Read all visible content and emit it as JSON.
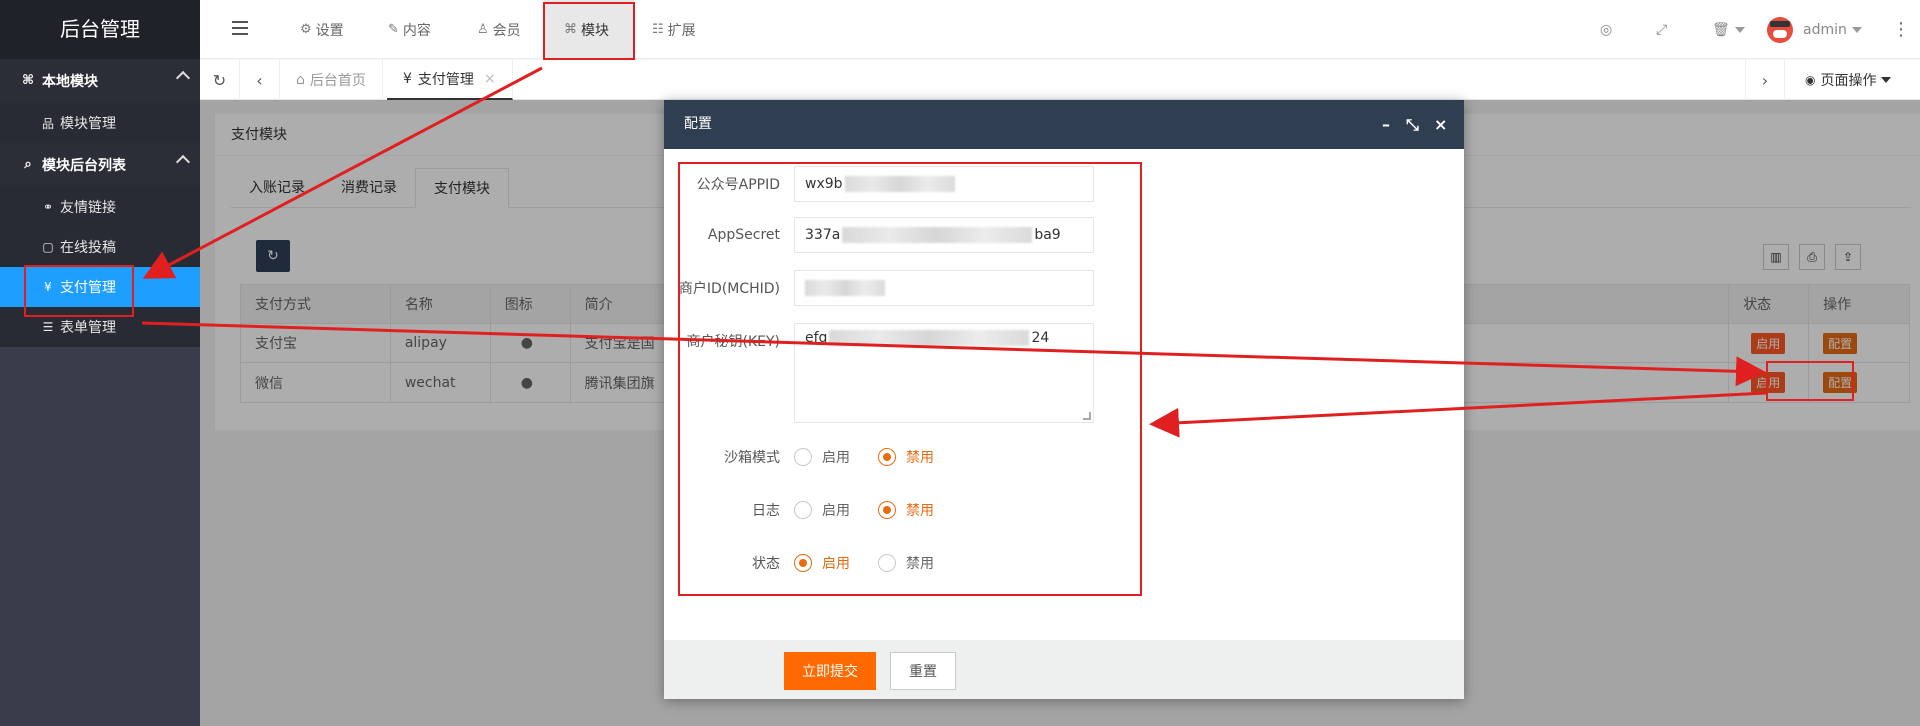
{
  "sidebar": {
    "logo": "后台管理",
    "groups": [
      {
        "label": "本地模块",
        "items": [
          {
            "label": "模块管理"
          }
        ]
      },
      {
        "label": "模块后台列表",
        "items": [
          {
            "label": "友情链接"
          },
          {
            "label": "在线投稿"
          },
          {
            "label": "支付管理"
          },
          {
            "label": "表单管理"
          }
        ]
      }
    ]
  },
  "header": {
    "nav": [
      {
        "label": "设置"
      },
      {
        "label": "内容"
      },
      {
        "label": "会员"
      },
      {
        "label": "模块"
      },
      {
        "label": "扩展"
      }
    ],
    "user": "admin"
  },
  "tabbar": {
    "tabs": [
      {
        "label": "后台首页"
      },
      {
        "label": "支付管理"
      }
    ],
    "page_ops": "页面操作"
  },
  "panel": {
    "title": "支付模块",
    "tabs": [
      "入账记录",
      "消费记录",
      "支付模块"
    ],
    "columns": [
      "支付方式",
      "名称",
      "图标",
      "简介",
      "状态",
      "操作"
    ],
    "rows": [
      {
        "method": "支付宝",
        "name": "alipay",
        "intro": "支付宝是国",
        "status": "启用",
        "action": "配置"
      },
      {
        "method": "微信",
        "name": "wechat",
        "intro": "腾讯集团旗",
        "status": "启用",
        "action": "配置"
      }
    ]
  },
  "modal": {
    "title": "配置",
    "fields": {
      "appid_label": "公众号APPID",
      "appid_value": "wx9b",
      "secret_label": "AppSecret",
      "secret_prefix": "337a",
      "secret_suffix": "ba9",
      "mchid_label": "商户ID(MCHID)",
      "key_label": "商户秘钥(KEY)",
      "key_prefix": "efg",
      "key_suffix": "24"
    },
    "radios": [
      {
        "label": "沙箱模式",
        "opt1": "启用",
        "opt2": "禁用",
        "selected": 2
      },
      {
        "label": "日志",
        "opt1": "启用",
        "opt2": "禁用",
        "selected": 2
      },
      {
        "label": "状态",
        "opt1": "启用",
        "opt2": "禁用",
        "selected": 1
      }
    ],
    "submit": "立即提交",
    "reset": "重置"
  },
  "colors": {
    "accent": "#e86b12",
    "sidebar_active": "#1e9fff",
    "annotation": "#e02020"
  }
}
